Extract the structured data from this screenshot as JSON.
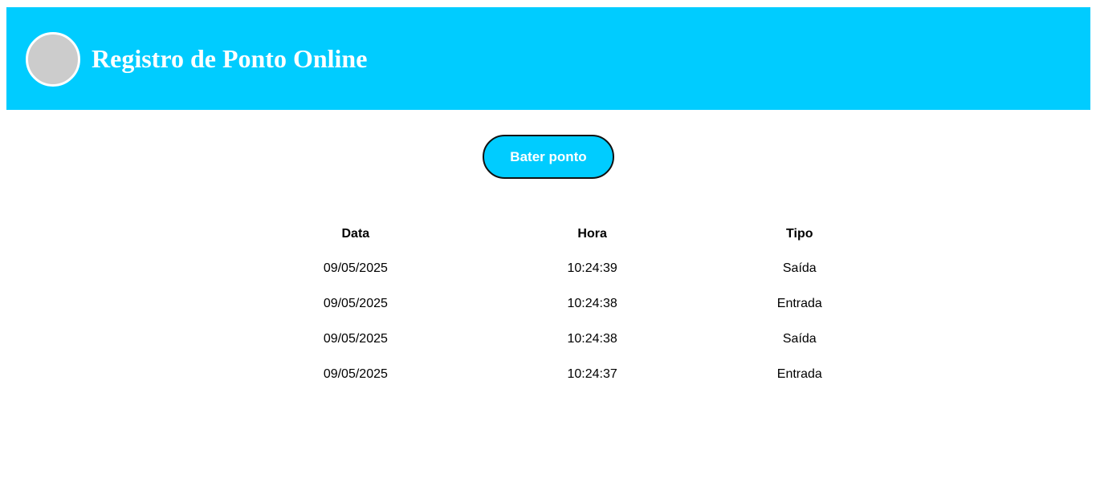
{
  "header": {
    "title": "Registro de Ponto Online"
  },
  "actions": {
    "punch_label": "Bater ponto"
  },
  "table": {
    "columns": [
      "Data",
      "Hora",
      "Tipo"
    ],
    "rows": [
      [
        "09/05/2025",
        "10:24:39",
        "Saída"
      ],
      [
        "09/05/2025",
        "10:24:38",
        "Entrada"
      ],
      [
        "09/05/2025",
        "10:24:38",
        "Saída"
      ],
      [
        "09/05/2025",
        "10:24:37",
        "Entrada"
      ]
    ]
  },
  "colors": {
    "accent": "#00ccff",
    "avatar_fill": "#cccccc"
  }
}
